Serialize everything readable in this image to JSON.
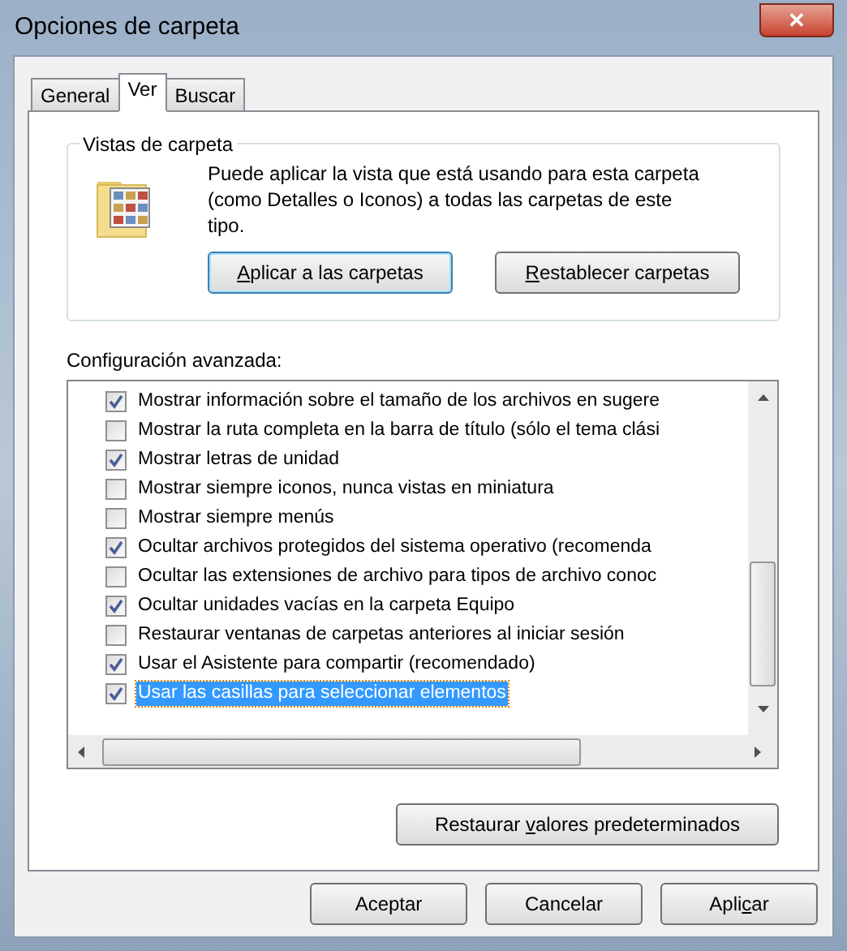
{
  "window": {
    "title": "Opciones de carpeta",
    "close": "✕"
  },
  "tabs": [
    {
      "label": "General",
      "selected": false
    },
    {
      "label": "Ver",
      "selected": true
    },
    {
      "label": "Buscar",
      "selected": false
    }
  ],
  "folder_views": {
    "title": "Vistas de carpeta",
    "description": "Puede aplicar la vista que está usando para esta carpeta (como Detalles o Iconos) a todas las carpetas de este tipo.",
    "buttons": [
      {
        "key": "A",
        "after": "plicar a las carpetas",
        "focused": true
      },
      {
        "key": "R",
        "after": "establecer carpetas",
        "focused": false
      }
    ]
  },
  "advanced": {
    "label": "Configuración avanzada:",
    "items": [
      {
        "label": "Mostrar información sobre el tamaño de los archivos en sugere",
        "checked": true,
        "selected": false
      },
      {
        "label": "Mostrar la ruta completa en la barra de título (sólo el tema clási",
        "checked": false,
        "selected": false
      },
      {
        "label": "Mostrar letras de unidad",
        "checked": true,
        "selected": false
      },
      {
        "label": "Mostrar siempre iconos, nunca vistas en miniatura",
        "checked": false,
        "selected": false
      },
      {
        "label": "Mostrar siempre menús",
        "checked": false,
        "selected": false
      },
      {
        "label": "Ocultar archivos protegidos del sistema operativo (recomenda",
        "checked": true,
        "selected": false
      },
      {
        "label": "Ocultar las extensiones de archivo para tipos de archivo conoc",
        "checked": false,
        "selected": false
      },
      {
        "label": "Ocultar unidades vacías en la carpeta Equipo",
        "checked": true,
        "selected": false
      },
      {
        "label": "Restaurar ventanas de carpetas anteriores al iniciar sesión",
        "checked": false,
        "selected": false
      },
      {
        "label": "Usar el Asistente para compartir (recomendado)",
        "checked": true,
        "selected": false
      },
      {
        "label": "Usar las casillas para seleccionar elementos",
        "checked": true,
        "selected": true
      }
    ],
    "restore_button": {
      "before": "Restaurar ",
      "key": "v",
      "after": "alores predeterminados"
    }
  },
  "footer_buttons": [
    {
      "before": "Aceptar"
    },
    {
      "before": "Cancelar"
    },
    {
      "before": "Apli",
      "key": "c",
      "after": "ar"
    }
  ]
}
